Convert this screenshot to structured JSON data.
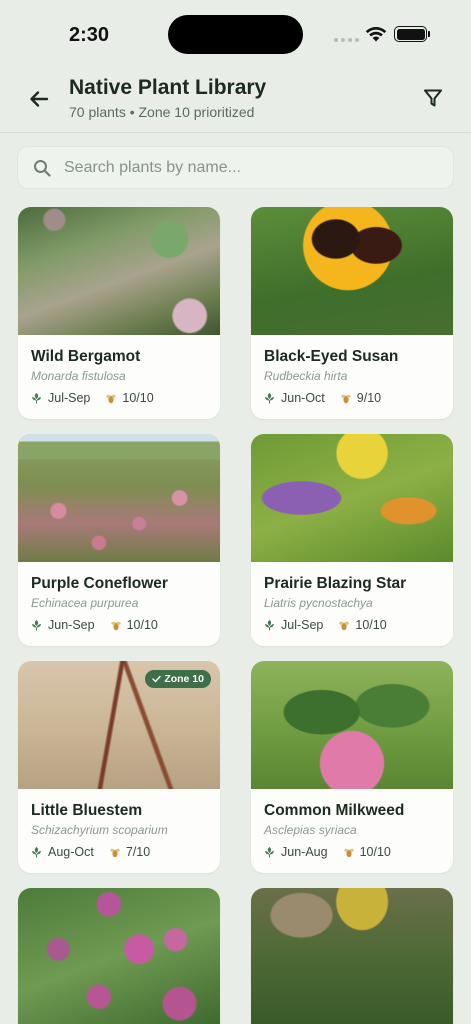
{
  "status_bar": {
    "time": "2:30"
  },
  "header": {
    "title": "Native Plant Library",
    "subtitle": "70 plants • Zone 10 prioritized",
    "back_icon": "arrow-left-icon",
    "filter_icon": "filter-icon"
  },
  "search": {
    "placeholder": "Search plants by name..."
  },
  "colors": {
    "background": "#e8eee7",
    "accent_green": "#3f6e4a",
    "bloom_icon": "#4a7a52",
    "pollinator_icon": "#c8903a"
  },
  "plants": [
    {
      "name": "Wild Bergamot",
      "scientific": "Monarda fistulosa",
      "bloom": "Jul-Sep",
      "score": "10/10",
      "badge": ""
    },
    {
      "name": "Black-Eyed Susan",
      "scientific": "Rudbeckia hirta",
      "bloom": "Jun-Oct",
      "score": "9/10",
      "badge": ""
    },
    {
      "name": "Purple Coneflower",
      "scientific": "Echinacea purpurea",
      "bloom": "Jun-Sep",
      "score": "10/10",
      "badge": ""
    },
    {
      "name": "Prairie Blazing Star",
      "scientific": "Liatris pycnostachya",
      "bloom": "Jul-Sep",
      "score": "10/10",
      "badge": ""
    },
    {
      "name": "Little Bluestem",
      "scientific": "Schizachyrium scoparium",
      "bloom": "Aug-Oct",
      "score": "7/10",
      "badge": "Zone 10"
    },
    {
      "name": "Common Milkweed",
      "scientific": "Asclepias syriaca",
      "bloom": "Jun-Aug",
      "score": "10/10",
      "badge": ""
    }
  ]
}
